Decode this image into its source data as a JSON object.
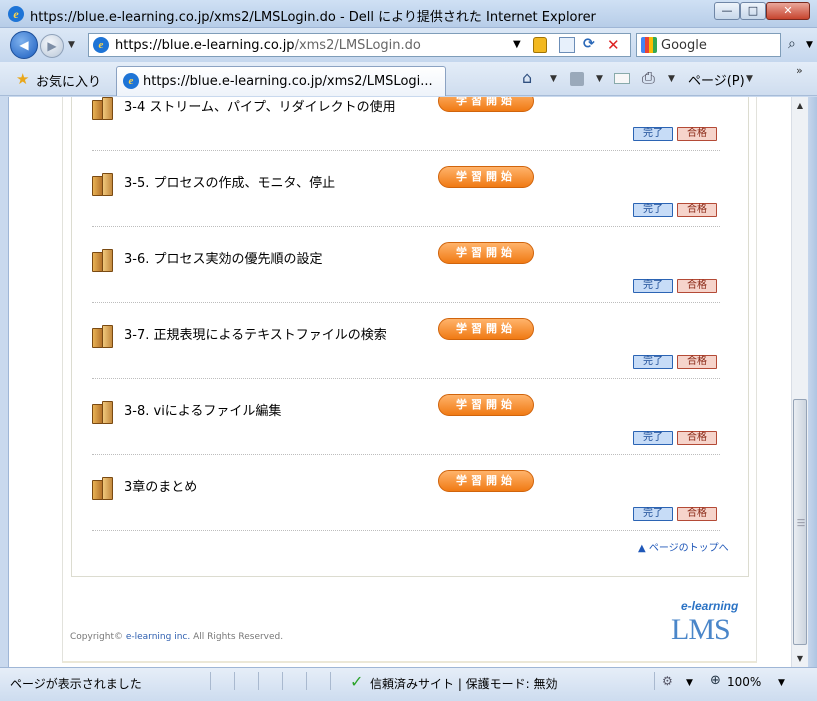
{
  "window": {
    "title": "https://blue.e-learning.co.jp/xms2/LMSLogin.do - Dell により提供された Internet Explorer",
    "min_glyph": "—",
    "max_glyph": "□",
    "close_glyph": "✕"
  },
  "address": {
    "host": "https://blue.e-learning.co.jp",
    "path": "/xms2/LMSLogin.do"
  },
  "search": {
    "provider": "Google"
  },
  "favorites": {
    "label": "お気に入り"
  },
  "tab": {
    "label": "https://blue.e-learning.co.jp/xms2/LMSLogi..."
  },
  "command_bar": {
    "page_label": "ページ(P)"
  },
  "lessons": [
    {
      "title": "3-4 ストリーム、パイプ、リダイレクトの使用",
      "start_label": "学習開始",
      "complete_label": "完了",
      "pass_label": "合格"
    },
    {
      "title": "3-5. プロセスの作成、モニタ、停止",
      "start_label": "学習開始",
      "complete_label": "完了",
      "pass_label": "合格"
    },
    {
      "title": "3-6. プロセス実効の優先順の設定",
      "start_label": "学習開始",
      "complete_label": "完了",
      "pass_label": "合格"
    },
    {
      "title": "3-7. 正規表現によるテキストファイルの検索",
      "start_label": "学習開始",
      "complete_label": "完了",
      "pass_label": "合格"
    },
    {
      "title": "3-8. viによるファイル編集",
      "start_label": "学習開始",
      "complete_label": "完了",
      "pass_label": "合格"
    },
    {
      "title": "3章のまとめ",
      "start_label": "学習開始",
      "complete_label": "完了",
      "pass_label": "合格"
    }
  ],
  "page_top_link": "▲ ページのトップへ",
  "footer": {
    "copyright_prefix": "Copyright© ",
    "copyright_brand": "e-learning inc.",
    "copyright_suffix": " All Rights Reserved.",
    "logo_top": "e-learning",
    "logo_mark": "LMS"
  },
  "statusbar": {
    "message": "ページが表示されました",
    "zone": "信頼済みサイト | 保護モード: 無効",
    "zoom": "100%"
  },
  "icons": {
    "back": "back-arrow-icon",
    "forward": "forward-arrow-icon",
    "home": "home-icon",
    "feeds": "feed-icon",
    "mail": "mail-icon",
    "print": "print-icon",
    "favorites": "star-icon",
    "search": "magnifier-icon",
    "lock": "lock-icon"
  },
  "colors": {
    "start_button": "#f07a14",
    "complete_badge": "#2b64b4",
    "pass_badge": "#b44a36",
    "link": "#1f57b8"
  }
}
